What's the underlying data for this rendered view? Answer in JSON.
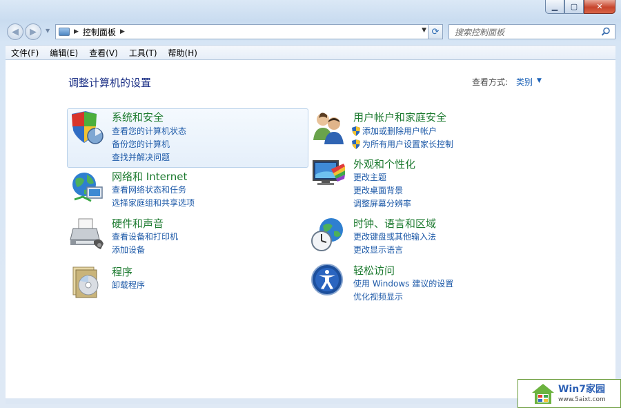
{
  "window": {
    "minimize_label": "▁",
    "maximize_label": "▢",
    "close_label": "✕"
  },
  "address_bar": {
    "path": "控制面板",
    "search_placeholder": "搜索控制面板"
  },
  "menu": [
    "文件(F)",
    "编辑(E)",
    "查看(V)",
    "工具(T)",
    "帮助(H)"
  ],
  "page": {
    "title": "调整计算机的设置",
    "view_label": "查看方式:",
    "view_value": "类别"
  },
  "categories": {
    "security": {
      "title": "系统和安全",
      "links": [
        "查看您的计算机状态",
        "备份您的计算机",
        "查找并解决问题"
      ]
    },
    "network": {
      "title": "网络和 Internet",
      "links": [
        "查看网络状态和任务",
        "选择家庭组和共享选项"
      ]
    },
    "hardware": {
      "title": "硬件和声音",
      "links": [
        "查看设备和打印机",
        "添加设备"
      ]
    },
    "programs": {
      "title": "程序",
      "links": [
        "卸载程序"
      ]
    },
    "users": {
      "title": "用户帐户和家庭安全",
      "links": [
        "添加或删除用户帐户",
        "为所有用户设置家长控制"
      ]
    },
    "appearance": {
      "title": "外观和个性化",
      "links": [
        "更改主题",
        "更改桌面背景",
        "调整屏幕分辨率"
      ]
    },
    "clock": {
      "title": "时钟、语言和区域",
      "links": [
        "更改键盘或其他输入法",
        "更改显示语言"
      ]
    },
    "ease": {
      "title": "轻松访问",
      "links": [
        "使用 Windows 建议的设置",
        "优化视频显示"
      ]
    }
  },
  "watermark": {
    "title": "Win7家园",
    "url": "www.5aixt.com"
  }
}
